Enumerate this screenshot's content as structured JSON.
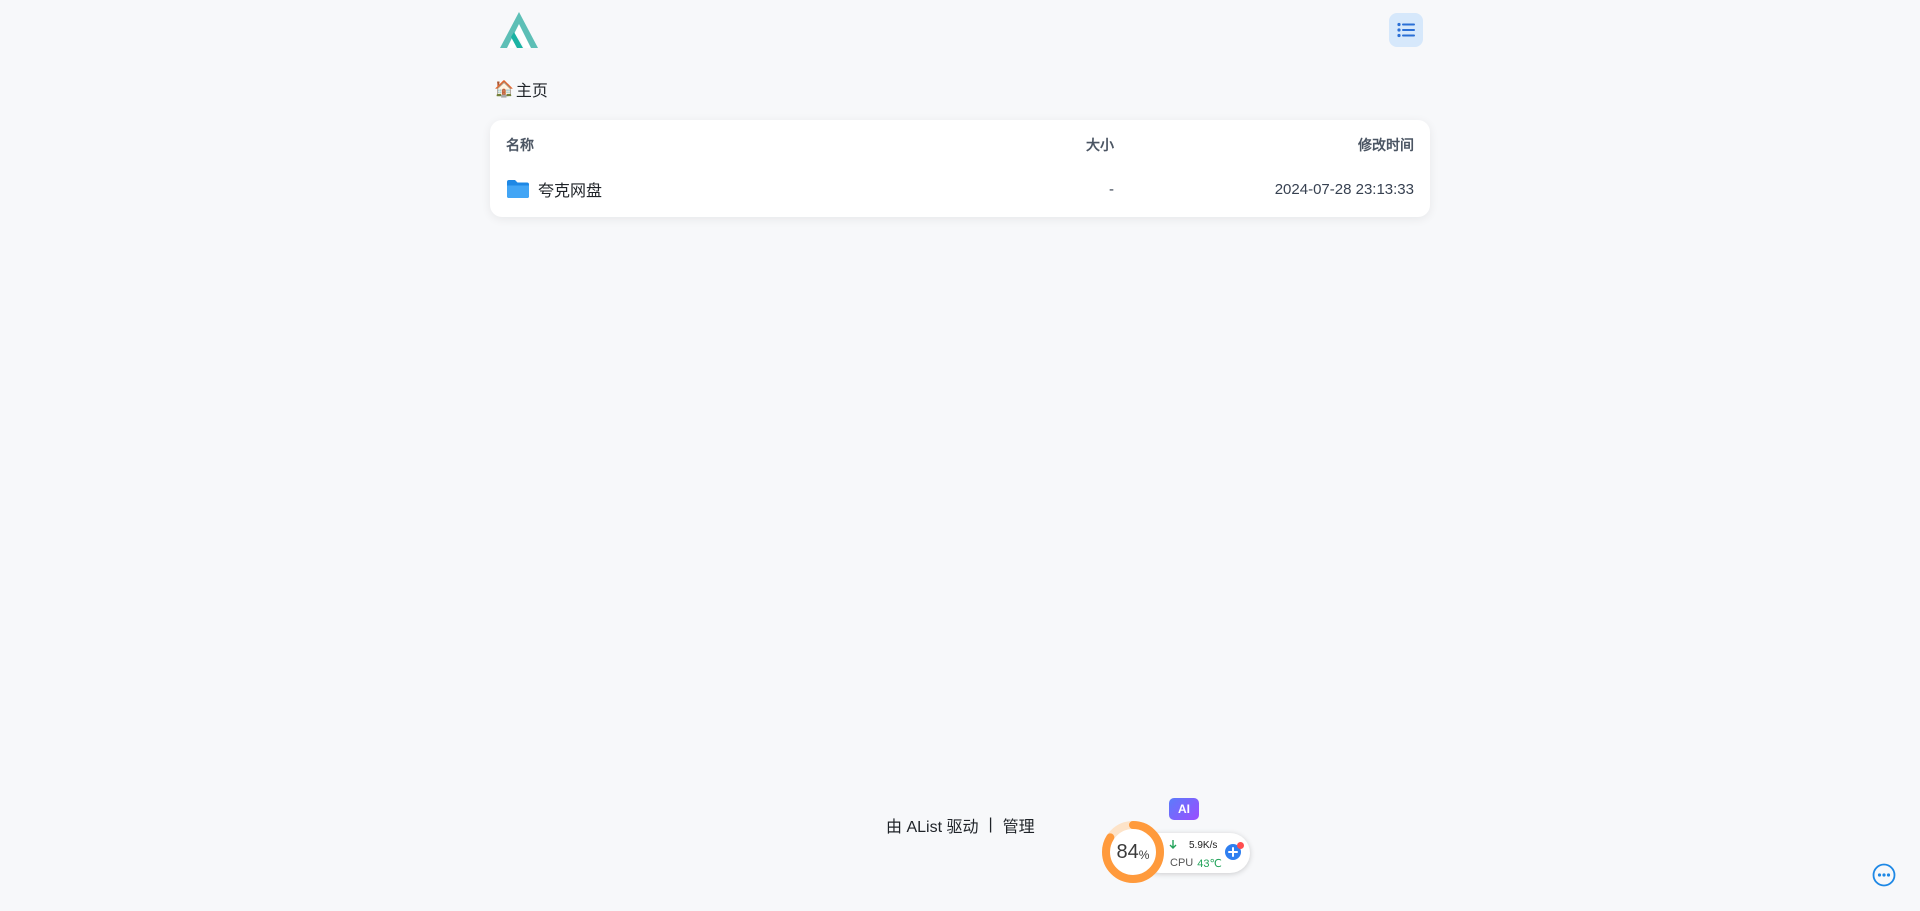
{
  "breadcrumb": {
    "home_emoji": "🏠",
    "home_label": "主页"
  },
  "table": {
    "headers": {
      "name": "名称",
      "size": "大小",
      "modified": "修改时间"
    },
    "rows": [
      {
        "name": "夸克网盘",
        "size": "-",
        "modified": "2024-07-28 23:13:33",
        "icon": "folder-icon"
      }
    ]
  },
  "footer": {
    "powered_by": "由 AList 驱动",
    "separator": "|",
    "admin_link": "管理"
  },
  "monitor": {
    "ai_badge": "AI",
    "usage_percent_value": "84",
    "usage_percent_unit": "%",
    "usage_percent": 84,
    "net_speed": "5.9K/s",
    "cpu_label": "CPU",
    "cpu_temp": "43℃"
  },
  "colors": {
    "accent": "#1e88e5",
    "logo_primary": "#1bb3a3",
    "logo_secondary": "#5dbfb6",
    "gauge_orange": "#ff9a3c",
    "menu_bg": "#d6e8fb",
    "page_bg": "#f7f8fa"
  },
  "icons": {
    "logo": "alist-logo-icon",
    "menu": "list-menu-icon",
    "home": "home-icon",
    "folder": "folder-icon",
    "net_down": "arrow-down-icon",
    "plus": "plus-icon",
    "more": "more-horizontal-icon"
  }
}
